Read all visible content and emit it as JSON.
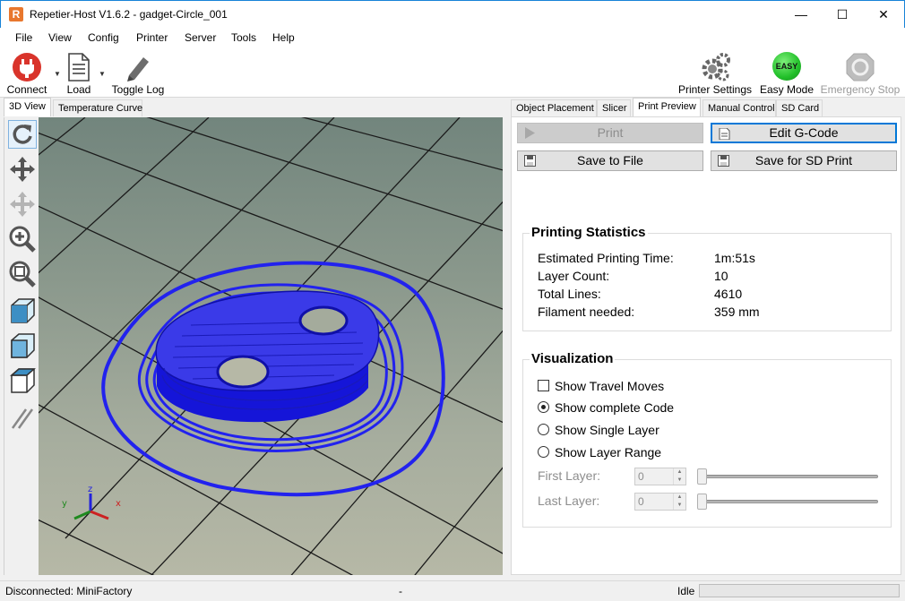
{
  "window": {
    "title": "Repetier-Host V1.6.2 - gadget-Circle_001",
    "app_icon": "R",
    "minimize_glyph": "—",
    "maximize_glyph": "☐",
    "close_glyph": "✕"
  },
  "menu": [
    "File",
    "View",
    "Config",
    "Printer",
    "Server",
    "Tools",
    "Help"
  ],
  "toolbar": {
    "connect": "Connect",
    "load": "Load",
    "toggle_log": "Toggle Log",
    "printer_settings": "Printer Settings",
    "easy_mode": "Easy Mode",
    "easy_badge": "EASY",
    "emergency_stop": "Emergency Stop"
  },
  "left_tabs": [
    "3D View",
    "Temperature Curve"
  ],
  "right_tabs": [
    "Object Placement",
    "Slicer",
    "Print Preview",
    "Manual Control",
    "SD Card"
  ],
  "actions": {
    "print": "Print",
    "edit_gcode": "Edit G-Code",
    "save_to_file": "Save to File",
    "save_sd": "Save for SD Print"
  },
  "stats": {
    "title": "Printing Statistics",
    "rows": [
      {
        "label": "Estimated Printing Time:",
        "value": "1m:51s"
      },
      {
        "label": "Layer Count:",
        "value": "10"
      },
      {
        "label": "Total Lines:",
        "value": "4610"
      },
      {
        "label": "Filament needed:",
        "value": "359 mm"
      }
    ]
  },
  "visualization": {
    "title": "Visualization",
    "show_travel": "Show Travel Moves",
    "show_complete": "Show complete Code",
    "show_single": "Show Single Layer",
    "show_range": "Show Layer Range",
    "first_layer_label": "First Layer:",
    "first_layer_value": "0",
    "last_layer_label": "Last Layer:",
    "last_layer_value": "0",
    "selected": "show_complete"
  },
  "status": {
    "connection": "Disconnected: MiniFactory",
    "center": "-",
    "state": "Idle"
  },
  "colors": {
    "accent": "#0078d7",
    "gcode_path": "#2222ee",
    "connect_red": "#d9342b",
    "easy_green": "#22c02a"
  }
}
